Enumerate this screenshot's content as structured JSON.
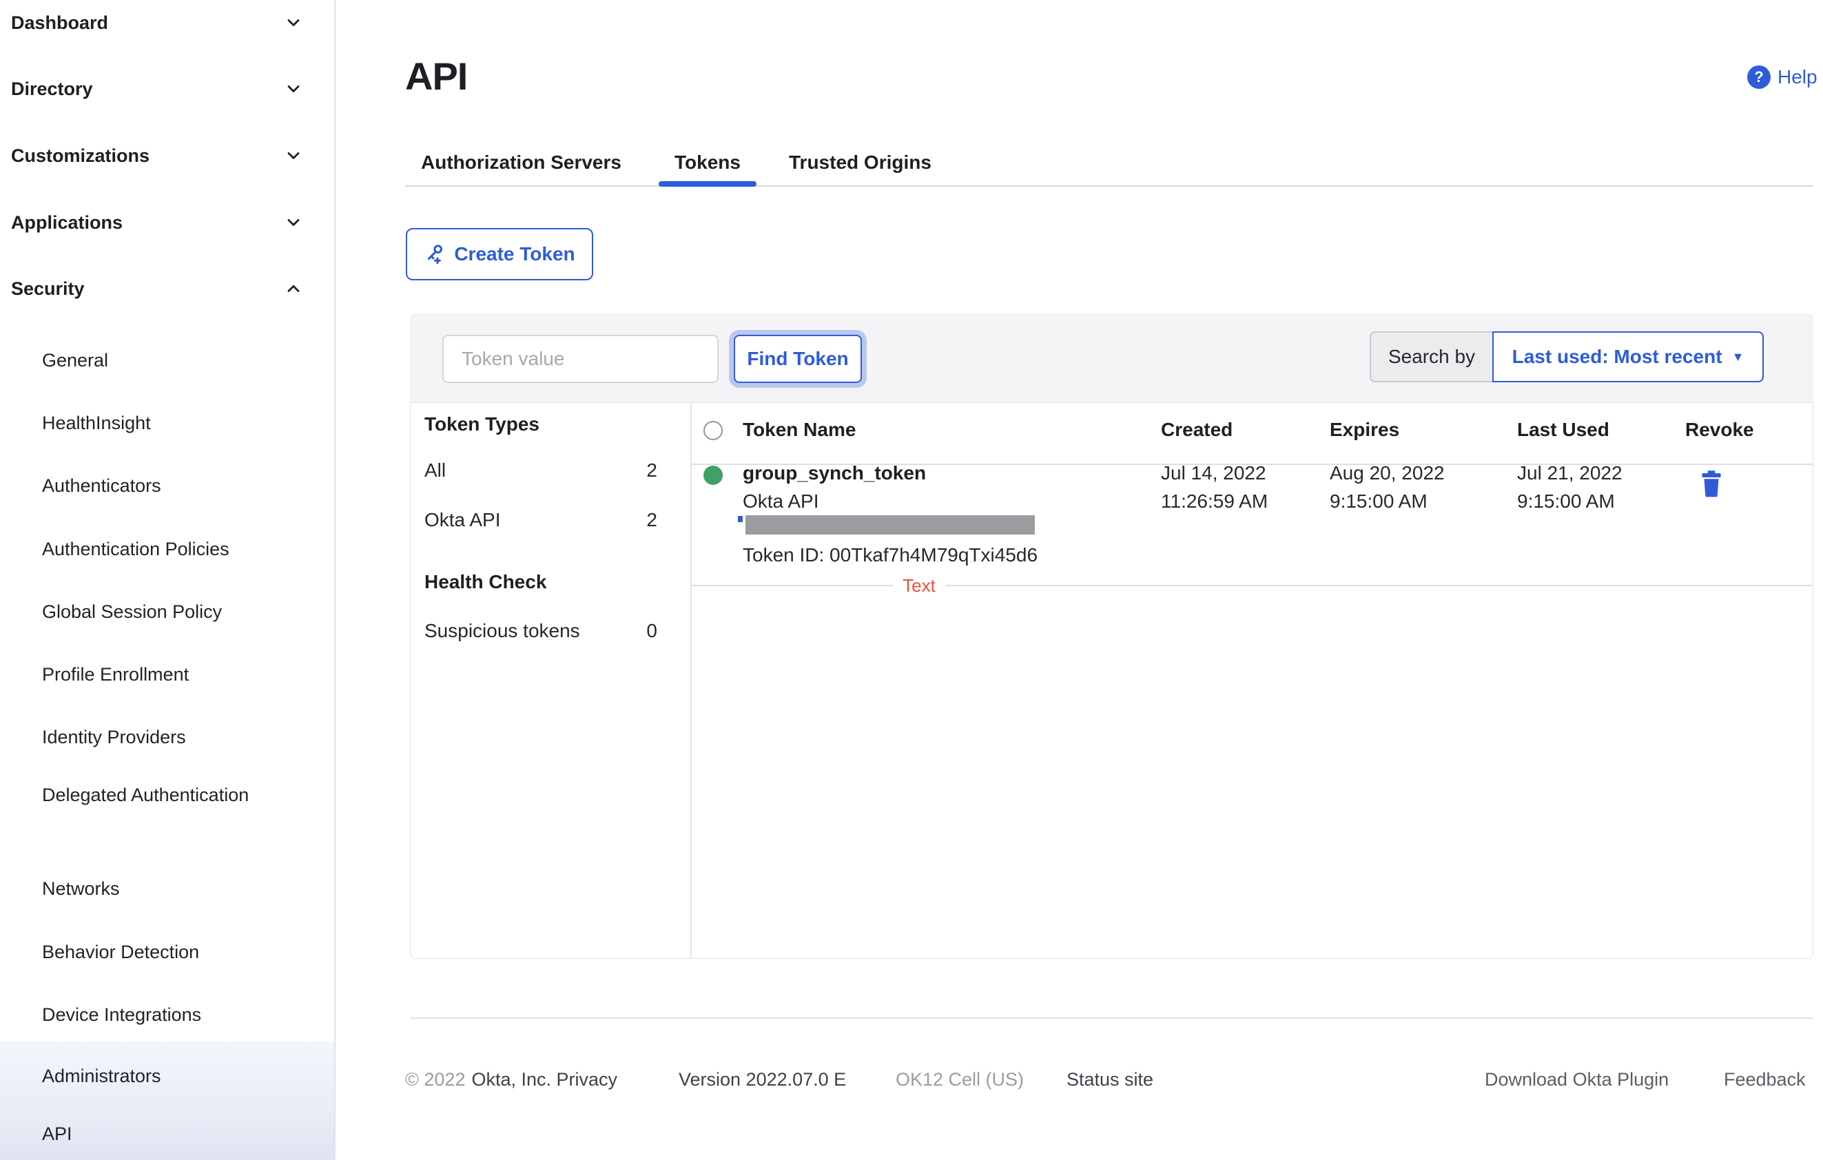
{
  "sidebar": {
    "top_items": [
      {
        "label": "Dashboard",
        "expanded": false
      },
      {
        "label": "Directory",
        "expanded": false
      },
      {
        "label": "Customizations",
        "expanded": false
      },
      {
        "label": "Applications",
        "expanded": false
      },
      {
        "label": "Security",
        "expanded": true
      }
    ],
    "security_items": [
      "General",
      "HealthInsight",
      "Authenticators",
      "Authentication Policies",
      "Global Session Policy",
      "Profile Enrollment",
      "Identity Providers",
      "Delegated Authentication",
      "Networks",
      "Behavior Detection",
      "Device Integrations",
      "Administrators",
      "API"
    ],
    "active_item": "API"
  },
  "header": {
    "title": "API",
    "help_label": "Help",
    "help_icon": "?"
  },
  "tabs": [
    {
      "label": "Authorization Servers",
      "active": false
    },
    {
      "label": "Tokens",
      "active": true
    },
    {
      "label": "Trusted Origins",
      "active": false
    }
  ],
  "actions": {
    "create_token_label": "Create Token"
  },
  "toolbar": {
    "token_value_placeholder": "Token value",
    "find_token_label": "Find Token",
    "search_by_label": "Search by",
    "sort_value": "Last used: Most recent",
    "sort_caret": "▼"
  },
  "token_types_panel": {
    "title": "Token Types",
    "items": [
      {
        "label": "All",
        "count": "2"
      },
      {
        "label": "Okta API",
        "count": "2"
      }
    ],
    "health_title": "Health Check",
    "health_items": [
      {
        "label": "Suspicious tokens",
        "count": "0"
      }
    ]
  },
  "table": {
    "columns": [
      "Token Name",
      "Created",
      "Expires",
      "Last Used",
      "Revoke"
    ],
    "rows": [
      {
        "name": "group_synch_token",
        "type": "Okta API",
        "token_id": "Token ID: 00Tkaf7h4M79qTxi45d6",
        "status": "active",
        "created_date": "Jul 14, 2022",
        "created_time": "11:26:59 AM",
        "expires_date": "Aug 20, 2022",
        "expires_time": "9:15:00 AM",
        "last_used_date": "Jul 21, 2022",
        "last_used_time": "9:15:00 AM"
      }
    ]
  },
  "annotation": {
    "label": "Text"
  },
  "footer": {
    "copyright": "© 2022",
    "company_privacy": "Okta, Inc. Privacy",
    "version": "Version 2022.07.0 E",
    "cell": "OK12 Cell (US)",
    "status_site": "Status site",
    "download_plugin": "Download Okta Plugin",
    "feedback": "Feedback"
  },
  "colors": {
    "accent_blue": "#2e5cd9",
    "status_green": "#3fa168",
    "annotation_red": "#e8513b",
    "redaction_gray": "#9a9c9f",
    "highlight_bg": "#e7ebf6"
  }
}
